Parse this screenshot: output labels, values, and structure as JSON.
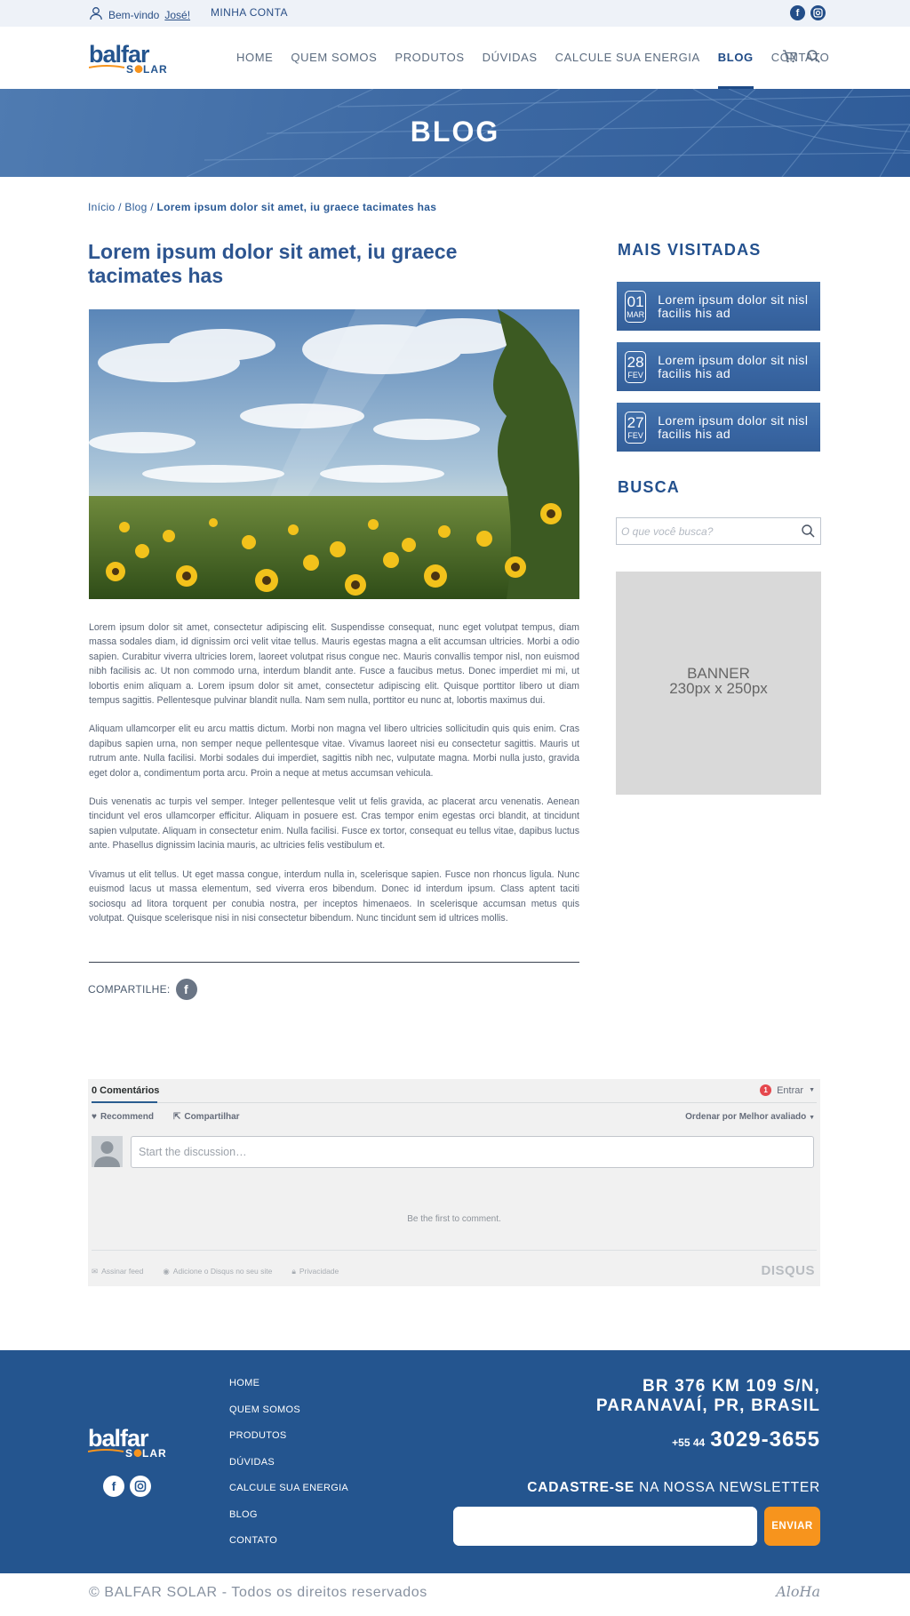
{
  "topbar": {
    "welcome_prefix": "Bem-vindo",
    "welcome_name": "José!",
    "account": "MINHA CONTA",
    "socials": [
      "facebook-icon",
      "instagram-icon"
    ]
  },
  "brand": {
    "name_top": "balfar",
    "name_bottom": "SOLAR",
    "colors": {
      "primary": "#24558f",
      "accent": "#f7941d"
    }
  },
  "nav": {
    "items": [
      "HOME",
      "QUEM SOMOS",
      "PRODUTOS",
      "DÚVIDAS",
      "CALCULE SUA ENERGIA",
      "BLOG",
      "CONTATO"
    ],
    "active": "BLOG"
  },
  "hero": {
    "title": "BLOG"
  },
  "breadcrumb": {
    "home": "Início",
    "sep": " / ",
    "blog": "Blog",
    "current": "Lorem ipsum dolor sit amet, iu graece tacimates has"
  },
  "article": {
    "title": "Lorem ipsum dolor sit amet, iu graece tacimates has",
    "paragraphs": [
      "Lorem ipsum dolor sit amet, consectetur adipiscing elit. Suspendisse consequat, nunc eget volutpat tempus, diam massa sodales diam, id dignissim orci velit vitae tellus. Mauris egestas magna a elit accumsan ultricies. Morbi a odio sapien. Curabitur viverra ultricies lorem, laoreet volutpat risus congue nec. Mauris convallis tempor nisl, non euismod nibh facilisis ac. Ut non commodo urna, interdum blandit ante. Fusce a faucibus metus. Donec imperdiet mi mi, ut lobortis enim aliquam a. Lorem ipsum dolor sit amet, consectetur adipiscing elit. Quisque porttitor libero ut diam tempus sagittis. Pellentesque pulvinar blandit nulla. Nam sem nulla, porttitor eu nunc at, lobortis maximus dui.",
      "Aliquam ullamcorper elit eu arcu mattis dictum. Morbi non magna vel libero ultricies sollicitudin quis quis enim. Cras dapibus sapien urna, non semper neque pellentesque vitae. Vivamus laoreet nisi eu consectetur sagittis. Mauris ut rutrum ante. Nulla facilisi. Morbi sodales dui imperdiet, sagittis nibh nec, vulputate magna. Morbi nulla justo, gravida eget dolor a, condimentum porta arcu. Proin a neque at metus accumsan vehicula.",
      "Duis venenatis ac turpis vel semper. Integer pellentesque velit ut felis gravida, ac placerat arcu venenatis. Aenean tincidunt vel eros ullamcorper efficitur. Aliquam in posuere est. Cras tempor enim egestas orci blandit, at tincidunt sapien vulputate. Aliquam in consectetur enim. Nulla facilisi. Fusce ex tortor, consequat eu tellus vitae, dapibus luctus ante. Phasellus dignissim lacinia mauris, ac ultricies felis vestibulum et.",
      "Vivamus ut elit tellus. Ut eget massa congue, interdum nulla in, scelerisque sapien. Fusce non rhoncus ligula. Nunc euismod lacus ut massa elementum, sed viverra eros bibendum. Donec id interdum ipsum. Class aptent taciti sociosqu ad litora torquent per conubia nostra, per inceptos himenaeos. In scelerisque accumsan metus quis volutpat. Quisque scelerisque nisi in nisi consectetur bibendum. Nunc tincidunt sem id ultrices mollis."
    ],
    "share_label": "COMPARTILHE:"
  },
  "sidebar": {
    "most_visited_title": "MAIS VISITADAS",
    "posts": [
      {
        "day": "01",
        "month": "MAR",
        "title": "Lorem ipsum dolor sit nisl facilis his ad"
      },
      {
        "day": "28",
        "month": "FEV",
        "title": "Lorem ipsum dolor sit nisl facilis his ad"
      },
      {
        "day": "27",
        "month": "FEV",
        "title": "Lorem ipsum dolor sit nisl facilis his ad"
      }
    ],
    "search_title": "BUSCA",
    "search_placeholder": "O que você busca?",
    "banner_line1": "BANNER",
    "banner_line2": "230px x 250px"
  },
  "comments": {
    "count_tab": "0 Comentários",
    "login_badge": "1",
    "login": "Entrar",
    "recommend": "Recommend",
    "share": "Compartilhar",
    "sort": "Ordenar por Melhor avaliado",
    "placeholder": "Start the discussion…",
    "empty": "Be the first to comment.",
    "footer_subscribe": "Assinar feed",
    "footer_add": "Adicione o Disqus no seu site",
    "footer_privacy": "Privacidade",
    "brand": "DISQUS"
  },
  "footer": {
    "links": [
      "HOME",
      "QUEM SOMOS",
      "PRODUTOS",
      "DÚVIDAS",
      "CALCULE SUA ENERGIA",
      "BLOG",
      "CONTATO"
    ],
    "address_line1": "BR 376 KM 109 S/N,",
    "address_line2": "PARANAVAÍ, PR,  BRASIL",
    "phone_prefix": "+55 44",
    "phone_number": "3029-3655",
    "newsletter_bold": "CADASTRE-SE",
    "newsletter_rest": " NA NOSSA NEWSLETTER",
    "send_label": "ENVIAR",
    "copyright": "© BALFAR SOLAR - Todos os direitos reservados",
    "agency": "AloHa"
  }
}
